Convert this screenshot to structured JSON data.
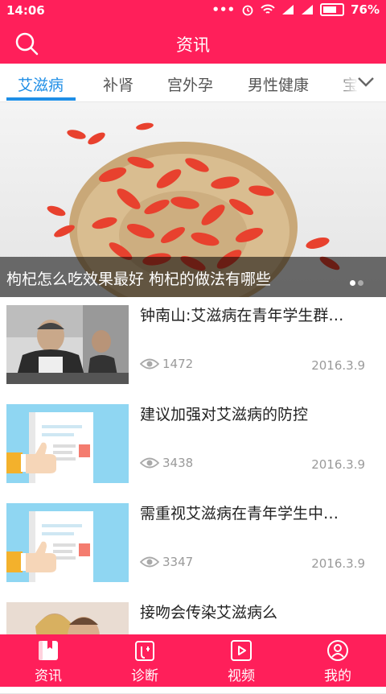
{
  "status_bar": {
    "time": "14:06",
    "battery": "76%",
    "icons": [
      "more-icon",
      "alarm-icon",
      "wifi-icon",
      "signal-icon",
      "signal-icon",
      "battery-icon"
    ]
  },
  "header": {
    "title": "资讯"
  },
  "tabs": [
    {
      "label": "艾滋病",
      "active": true
    },
    {
      "label": "补肾",
      "active": false
    },
    {
      "label": "宫外孕",
      "active": false
    },
    {
      "label": "男性健康",
      "active": false
    },
    {
      "label": "宝",
      "active": false
    }
  ],
  "banner": {
    "caption": "枸杞怎么吃效果最好 枸杞的做法有哪些",
    "slide_count": 2,
    "active_slide": 0
  },
  "articles": [
    {
      "title": "钟南山:艾滋病在青年学生群…",
      "views": "1472",
      "date": "2016.3.9",
      "thumb": "photo-meeting"
    },
    {
      "title": "建议加强对艾滋病的防控",
      "views": "3438",
      "date": "2016.3.9",
      "thumb": "document-thumbs-up"
    },
    {
      "title": "需重视艾滋病在青年学生中…",
      "views": "3347",
      "date": "2016.3.9",
      "thumb": "document-thumbs-up"
    },
    {
      "title": "接吻会传染艾滋病么",
      "views": "",
      "date": "",
      "thumb": "photo-kiss"
    }
  ],
  "bottom_nav": [
    {
      "label": "资讯",
      "icon": "news-book-icon",
      "active": true
    },
    {
      "label": "诊断",
      "icon": "diagnosis-icon",
      "active": false
    },
    {
      "label": "视频",
      "icon": "video-icon",
      "active": false
    },
    {
      "label": "我的",
      "icon": "user-icon",
      "active": false
    }
  ],
  "colors": {
    "brand": "#ff1f5a",
    "tab_active": "#1e8ee6",
    "meta_text": "#9a9a9a"
  }
}
